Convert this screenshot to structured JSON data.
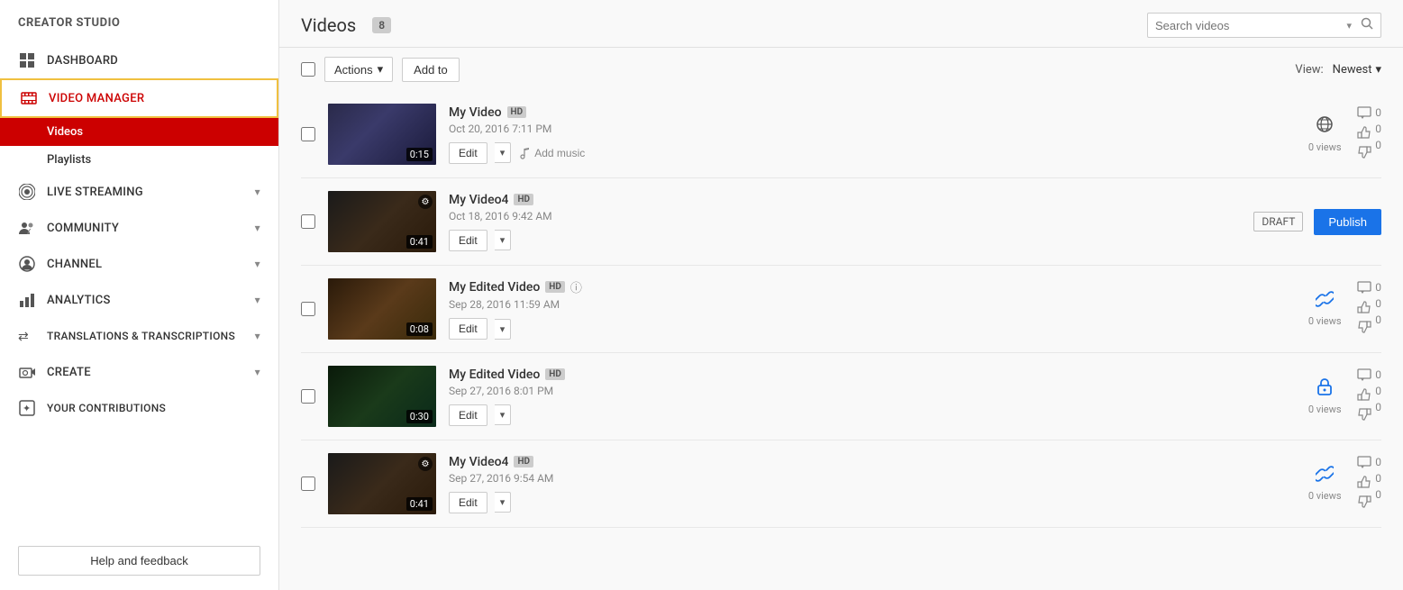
{
  "sidebar": {
    "title": "CREATOR STUDIO",
    "items": [
      {
        "id": "dashboard",
        "label": "DASHBOARD",
        "icon": "grid"
      },
      {
        "id": "video-manager",
        "label": "VIDEO MANAGER",
        "icon": "film",
        "active": true,
        "subitems": [
          {
            "id": "videos",
            "label": "Videos",
            "active": true
          },
          {
            "id": "playlists",
            "label": "Playlists",
            "active": false
          }
        ]
      },
      {
        "id": "live-streaming",
        "label": "LIVE STREAMING",
        "icon": "broadcast",
        "hasChevron": true
      },
      {
        "id": "community",
        "label": "COMMUNITY",
        "icon": "people",
        "hasChevron": true
      },
      {
        "id": "channel",
        "label": "CHANNEL",
        "icon": "person-circle",
        "hasChevron": true
      },
      {
        "id": "analytics",
        "label": "ANALYTICS",
        "icon": "bar-chart",
        "hasChevron": true
      },
      {
        "id": "translations",
        "label": "TRANSLATIONS & TRANSCRIPTIONS",
        "icon": "translate",
        "hasChevron": true
      },
      {
        "id": "create",
        "label": "CREATE",
        "icon": "camera",
        "hasChevron": true
      },
      {
        "id": "contributions",
        "label": "YOUR CONTRIBUTIONS",
        "icon": "contributions"
      }
    ],
    "help_label": "Help and feedback"
  },
  "header": {
    "title": "Videos",
    "count": "8",
    "search_placeholder": "Search videos"
  },
  "toolbar": {
    "actions_label": "Actions",
    "add_to_label": "Add to",
    "view_label": "View:",
    "view_value": "Newest"
  },
  "videos": [
    {
      "id": 1,
      "title": "My Video",
      "hd": true,
      "date": "Oct 20, 2016 7:11 PM",
      "duration": "0:15",
      "visibility": "public",
      "visibility_icon": "globe",
      "views": "0 views",
      "comments": "0",
      "likes": "0",
      "dislikes": "0",
      "has_add_music": true,
      "status": "public",
      "thumb_class": "thumb-1",
      "has_overlay": false
    },
    {
      "id": 2,
      "title": "My Video4",
      "hd": true,
      "date": "Oct 18, 2016 9:42 AM",
      "duration": "0:41",
      "visibility": "draft",
      "visibility_icon": "",
      "views": "",
      "comments": "",
      "likes": "",
      "dislikes": "",
      "has_add_music": false,
      "status": "draft",
      "thumb_class": "thumb-2",
      "has_overlay": true,
      "draft_label": "DRAFT",
      "publish_label": "Publish"
    },
    {
      "id": 3,
      "title": "My Edited Video",
      "hd": true,
      "date": "Sep 28, 2016 11:59 AM",
      "duration": "0:08",
      "visibility": "link",
      "visibility_icon": "link",
      "views": "0 views",
      "comments": "0",
      "likes": "0",
      "dislikes": "0",
      "has_add_music": false,
      "status": "link",
      "thumb_class": "thumb-3",
      "has_overlay": false,
      "has_info": true
    },
    {
      "id": 4,
      "title": "My Edited Video",
      "hd": true,
      "date": "Sep 27, 2016 8:01 PM",
      "duration": "0:30",
      "visibility": "private",
      "visibility_icon": "lock",
      "views": "0 views",
      "comments": "0",
      "likes": "0",
      "dislikes": "0",
      "has_add_music": false,
      "status": "private",
      "thumb_class": "thumb-4",
      "has_overlay": false
    },
    {
      "id": 5,
      "title": "My Video4",
      "hd": true,
      "date": "Sep 27, 2016 9:54 AM",
      "duration": "0:41",
      "visibility": "link",
      "visibility_icon": "link",
      "views": "0 views",
      "comments": "0",
      "likes": "0",
      "dislikes": "0",
      "has_add_music": false,
      "status": "link",
      "thumb_class": "thumb-5",
      "has_overlay": true
    }
  ],
  "icons": {
    "grid": "▦",
    "film": "▶",
    "broadcast": "◉",
    "people": "👥",
    "person": "👤",
    "bar": "📊",
    "translate": "⇄",
    "camera": "🎬",
    "contributions": "✦",
    "chevron": "▾",
    "search": "🔍",
    "globe": "🌐",
    "link": "🔗",
    "lock": "🔒",
    "music": "♪",
    "thumbup": "👍",
    "thumbdown": "👎",
    "comment": "💬",
    "dropdown": "▾"
  }
}
